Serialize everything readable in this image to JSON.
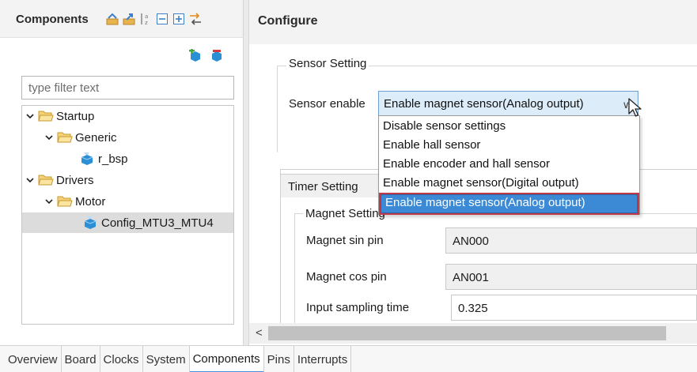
{
  "components_panel": {
    "title": "Components",
    "toolbar_icons": [
      "collapse-all-icon",
      "expand-all-icon",
      "sort-az-icon",
      "collapse-icon",
      "expand-icon",
      "link-icon"
    ],
    "add_icons": [
      "add-component-icon",
      "remove-component-icon"
    ],
    "filter": {
      "placeholder": "type filter text",
      "value": ""
    },
    "tree": {
      "startup": "Startup",
      "generic": "Generic",
      "r_bsp": "r_bsp",
      "drivers": "Drivers",
      "motor": "Motor",
      "config": "Config_MTU3_MTU4"
    }
  },
  "configure_panel": {
    "title": "Configure",
    "sensor_setting": {
      "group_title": "Sensor Setting",
      "enable_label": "Sensor enable",
      "selected_value": "Enable magnet sensor(Analog output)",
      "options": [
        "Disable sensor settings",
        "Enable hall sensor",
        "Enable encoder and hall sensor",
        "Enable magnet sensor(Digital output)",
        "Enable magnet sensor(Analog output)"
      ]
    },
    "timer_tab": "Timer Setting",
    "magnet_setting": {
      "group_title": "Magnet Setting",
      "sin_label": "Magnet sin pin",
      "sin_value": "AN000",
      "cos_label": "Magnet cos pin",
      "cos_value": "AN001",
      "sampling_label": "Input sampling time",
      "sampling_value": "0.325"
    },
    "scroll_left": "<"
  },
  "bottom_tabs": {
    "overview": "Overview",
    "board": "Board",
    "clocks": "Clocks",
    "system": "System",
    "components": "Components",
    "pins": "Pins",
    "interrupts": "Interrupts"
  },
  "colors": {
    "selection": "#3c8ad6",
    "highlight_outline": "#c0394a",
    "select_bg": "#dcecf9"
  }
}
